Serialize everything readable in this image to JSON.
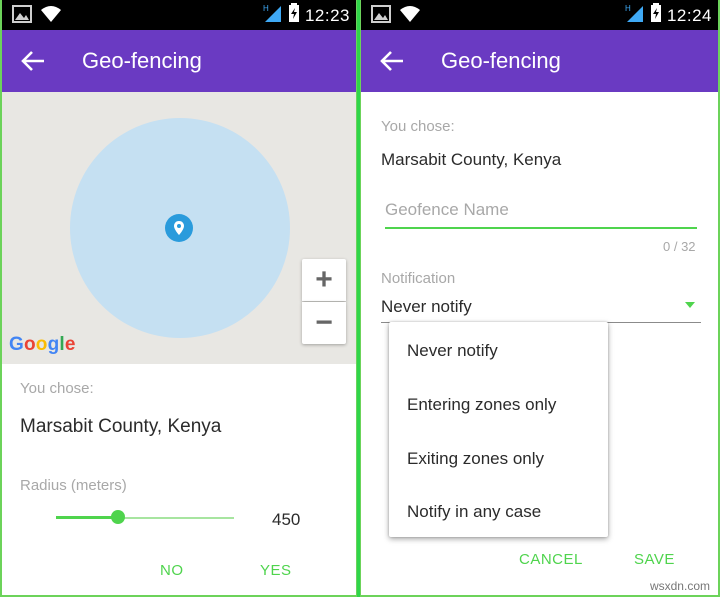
{
  "left": {
    "status_time": "12:23",
    "appbar_title": "Geo-fencing",
    "google_letters": [
      {
        "ch": "G",
        "color": "#4285f4"
      },
      {
        "ch": "o",
        "color": "#ea4335"
      },
      {
        "ch": "o",
        "color": "#fbbc05"
      },
      {
        "ch": "g",
        "color": "#4285f4"
      },
      {
        "ch": "l",
        "color": "#34a853"
      },
      {
        "ch": "e",
        "color": "#ea4335"
      }
    ],
    "zoom_in": "+",
    "zoom_out": "−",
    "you_chose_label": "You chose:",
    "location": "Marsabit County, Kenya",
    "radius_label": "Radius (meters)",
    "radius_value": "450",
    "radius_fraction": 0.35,
    "no_button": "NO",
    "yes_button": "YES"
  },
  "right": {
    "status_time": "12:24",
    "appbar_title": "Geo-fencing",
    "you_chose_label": "You chose:",
    "location": "Marsabit County, Kenya",
    "geofence_placeholder": "Geofence Name",
    "char_count": "0 / 32",
    "notification_label": "Notification",
    "notification_value": "Never notify",
    "menu_items": [
      "Never notify",
      "Entering zones only",
      "Exiting zones only",
      "Notify in any case"
    ],
    "cancel_button": "CANCEL",
    "save_button": "SAVE"
  },
  "watermark": "wsxdn.com",
  "colors": {
    "appbar": "#6a3ac2",
    "accent_green": "#4fd44d",
    "radius_circle": "#c5e0f2",
    "pin": "#2a9bdc"
  }
}
